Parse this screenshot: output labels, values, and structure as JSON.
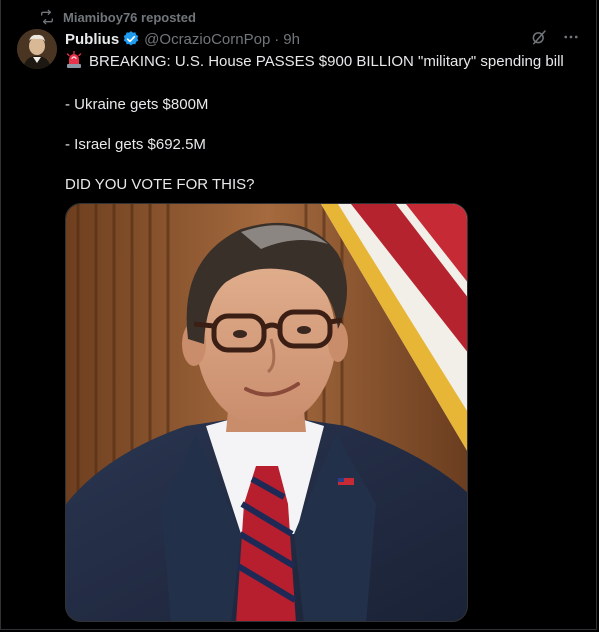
{
  "repost": {
    "icon": "repost-icon",
    "label": "Miamiboy76 reposted"
  },
  "author": {
    "display_name": "Publius",
    "verified_icon": "verified-badge-icon",
    "verified_color": "#1d9bf0",
    "handle": "@OcrazioCornPop",
    "separator": "·",
    "time": "9h"
  },
  "actions": {
    "grok_icon": "grok-icon",
    "more_icon": "more-options-icon"
  },
  "post": {
    "siren_icon": "police-light-emoji",
    "line1": "BREAKING: U.S. House PASSES $900 BILLION \"military\" spending bill",
    "line2": "- Ukraine gets $800M",
    "line3": "- Israel gets $692.5M",
    "line4": "DID YOU VOTE FOR THIS?"
  },
  "media": {
    "kind": "photo",
    "subject": "man in glasses and navy suit with striped tie in front of flag"
  },
  "colors": {
    "background": "#000000",
    "text": "#e7e9ea",
    "muted": "#71767b",
    "border": "#2f3336"
  }
}
